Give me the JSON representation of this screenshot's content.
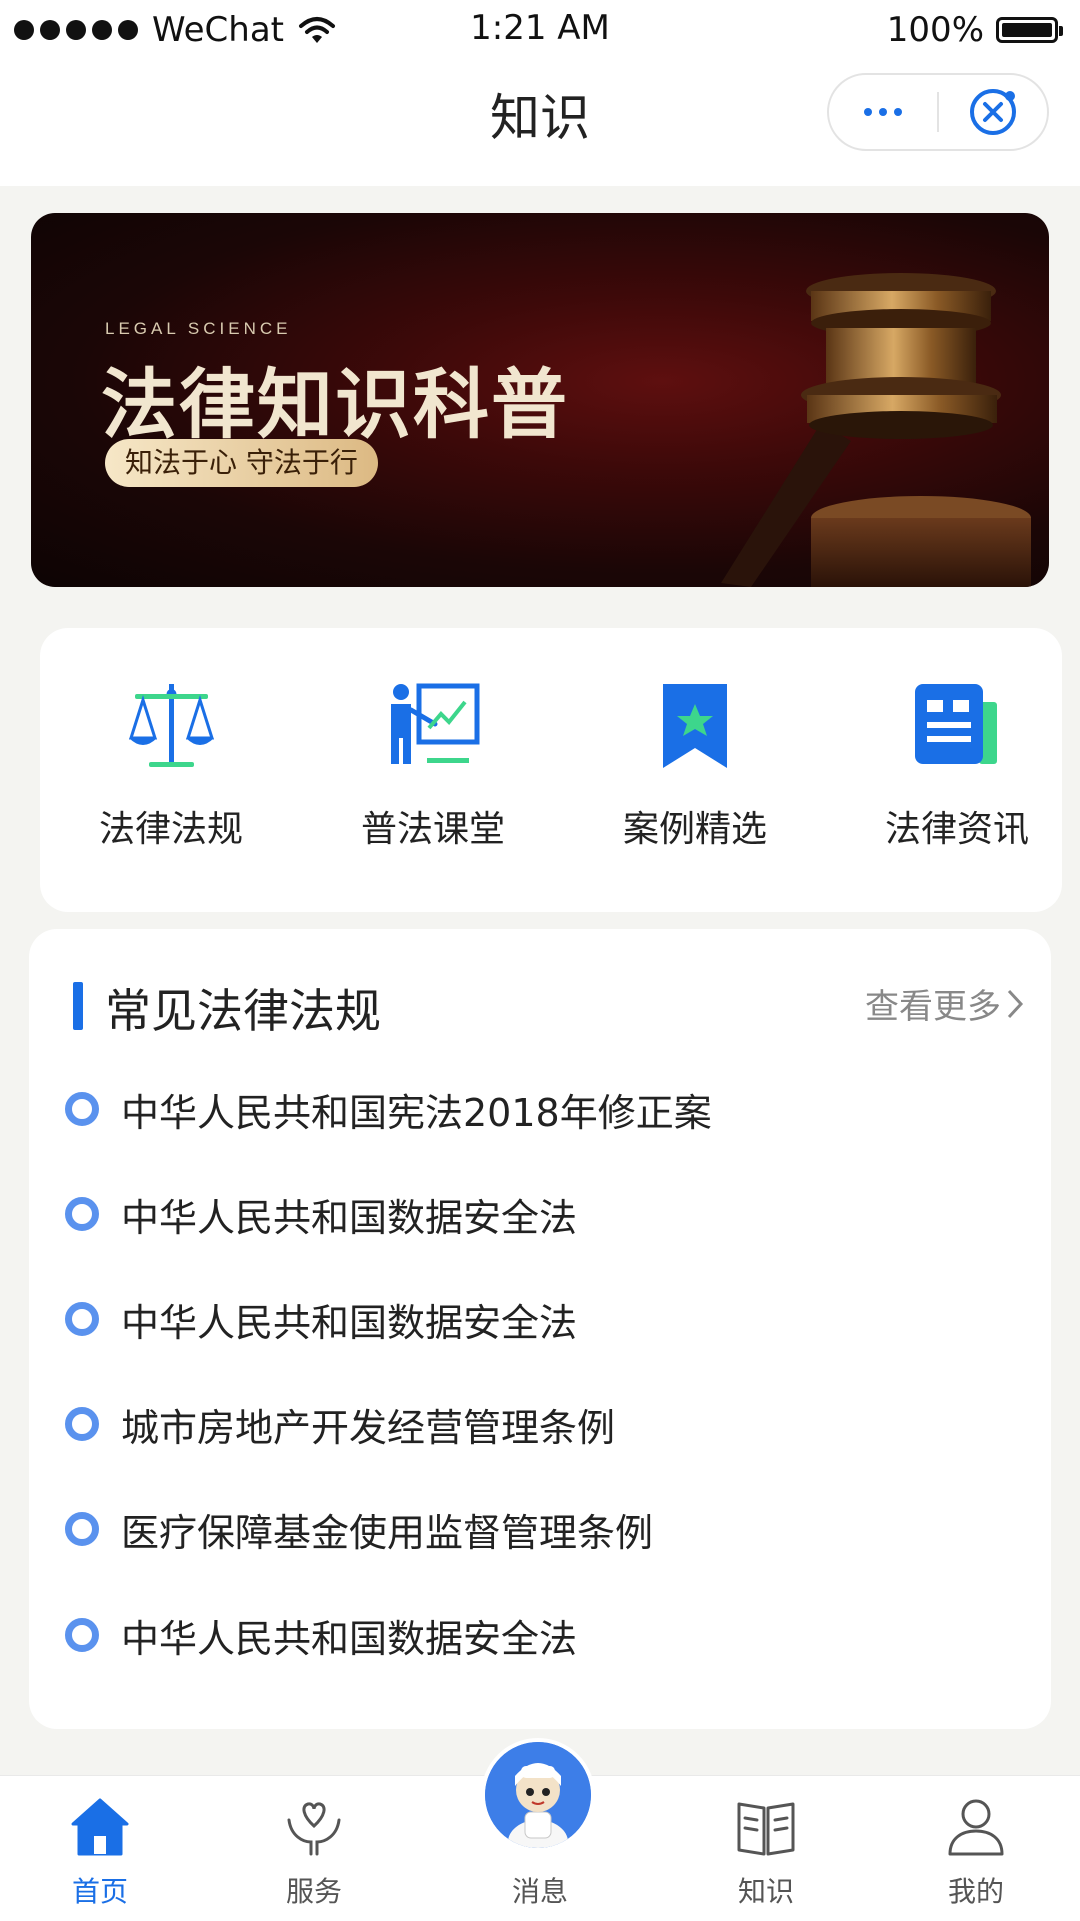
{
  "status_bar": {
    "carrier": "WeChat",
    "time": "1:21 AM",
    "battery": "100%"
  },
  "nav": {
    "title": "知识",
    "icons": [
      "more-dots-icon",
      "close-target-icon"
    ]
  },
  "banner": {
    "subtitle": "LEGAL SCIENCE",
    "title": "法律知识科普",
    "slogan": "知法于心 守法于行"
  },
  "quick_menu": [
    {
      "label": "法律法规",
      "icon": "scales-icon"
    },
    {
      "label": "普法课堂",
      "icon": "presentation-icon"
    },
    {
      "label": "案例精选",
      "icon": "bookmark-star-icon"
    },
    {
      "label": "法律资讯",
      "icon": "news-icon"
    }
  ],
  "laws_section": {
    "title": "常见法律法规",
    "more": "查看更多",
    "items": [
      "中华人民共和国宪法2018年修正案",
      "中华人民共和国数据安全法",
      "中华人民共和国数据安全法",
      "城市房地产开发经营管理条例",
      "医疗保障基金使用监督管理条例",
      "中华人民共和国数据安全法"
    ]
  },
  "tabbar": {
    "items": [
      {
        "label": "首页",
        "icon": "home-icon",
        "active": true
      },
      {
        "label": "服务",
        "icon": "heart-hands-icon",
        "active": false
      },
      {
        "label": "消息",
        "icon": "mascot-icon",
        "active": false
      },
      {
        "label": "知识",
        "icon": "book-icon",
        "active": false
      },
      {
        "label": "我的",
        "icon": "user-icon",
        "active": false
      }
    ]
  },
  "colors": {
    "accent": "#1a6fe6",
    "bullet": "#5a92ee",
    "page_bg": "#f4f4f1"
  }
}
